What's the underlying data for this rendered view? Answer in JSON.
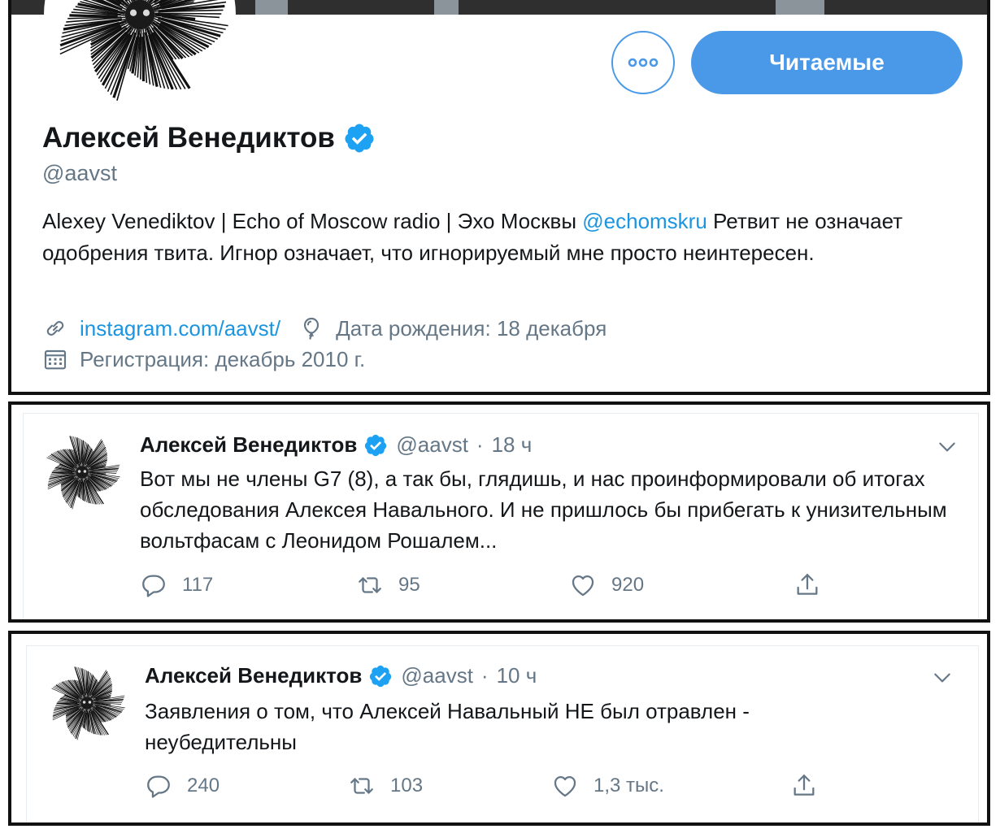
{
  "profile": {
    "name": "Алексей Венедиктов",
    "handle": "@aavst",
    "follow_label": "Читаемые",
    "more_icon": "more-dots-icon",
    "bio_before": "Alexey Venediktov | Echo of Moscow radio | Эхо Москвы ",
    "bio_mention": "@echomskru",
    "bio_after": "  Ретвит не означает одобрения твита. Игнор означает, что игнорируемый мне просто неинтересен.",
    "website": "instagram.com/aavst/",
    "birthday": "Дата рождения: 18 декабря",
    "joined": "Регистрация: декабрь 2010 г.",
    "icons": {
      "link": "link-icon",
      "birthday": "balloon-icon",
      "joined": "calendar-icon",
      "verified": "verified-badge-icon"
    }
  },
  "tweets": [
    {
      "author": "Алексей Венедиктов",
      "handle": "@aavst",
      "dot": "·",
      "time": "18 ч",
      "text": "Вот мы не члены G7 (8), а так бы, глядишь, и нас проинформировали об итогах обследования Алексея Навального. И не пришлось бы прибегать к унизительным вольтфасам с Леонидом Рошалем...",
      "replies": "117",
      "retweets": "95",
      "likes": "920"
    },
    {
      "author": "Алексей Венедиктов",
      "handle": "@aavst",
      "dot": "·",
      "time": "10 ч",
      "text": "Заявления о том, что Алексей Навальный НЕ был отравлен - неубедительны",
      "replies": "240",
      "retweets": "103",
      "likes": "1,3 тыс."
    }
  ],
  "colors": {
    "accent": "#4a99e9",
    "link": "#1b95e0",
    "secondary_text": "#657786",
    "primary_text": "#14171a",
    "panel_border": "#111111"
  }
}
